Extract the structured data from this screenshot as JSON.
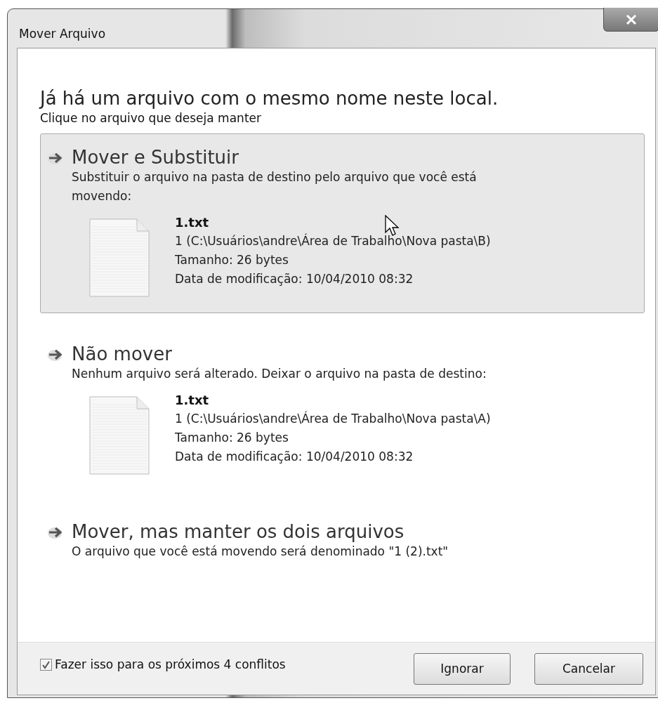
{
  "window": {
    "title": "Mover Arquivo"
  },
  "heading": "Já há um arquivo com o mesmo nome neste local.",
  "instruction": "Clique no arquivo que deseja manter",
  "options": [
    {
      "kind": "file",
      "selected": true,
      "title": "Mover e Substituir",
      "description": "Substituir o arquivo na pasta de destino pelo arquivo que você está movendo:",
      "file": {
        "name": "1.txt",
        "location": "1 (C:\\Usuários\\andre\\Área de Trabalho\\Nova pasta\\B)",
        "size": "Tamanho: 26 bytes",
        "modified": "Data de modificação: 10/04/2010 08:32"
      }
    },
    {
      "kind": "file",
      "selected": false,
      "title": "Não mover",
      "description": "Nenhum arquivo será alterado. Deixar o arquivo na pasta de destino:",
      "file": {
        "name": "1.txt",
        "location": "1 (C:\\Usuários\\andre\\Área de Trabalho\\Nova pasta\\A)",
        "size": "Tamanho: 26 bytes",
        "modified": "Data de modificação: 10/04/2010 08:32"
      }
    },
    {
      "kind": "plain",
      "selected": false,
      "title": "Mover, mas manter os dois arquivos",
      "description": "O arquivo que você está movendo será denominado \"1 (2).txt\""
    }
  ],
  "footer": {
    "checkbox": {
      "label": "Fazer isso para os próximos 4 conflitos",
      "checked": true
    },
    "buttons": [
      "Ignorar",
      "Cancelar"
    ]
  }
}
